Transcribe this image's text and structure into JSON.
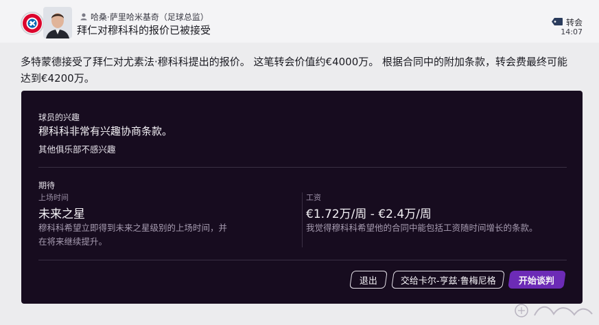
{
  "header": {
    "sender_name": "哈桑·萨里哈米基奇（足球总监）",
    "subject": "拜仁对穆科科的报价已被接受",
    "tag_label": "转会",
    "time": "14:07"
  },
  "message": {
    "body": "多特蒙德接受了拜仁对尤素法·穆科科提出的报价。 这笔转会价值约€4000万。 根据合同中的附加条款，转会费最终可能达到€4200万。"
  },
  "panel": {
    "interest": {
      "label": "球员的兴趣",
      "main": "穆科科非常有兴趣协商条款。",
      "sub": "其他俱乐部不感兴趣"
    },
    "expectation": {
      "label": "期待",
      "playing_time": {
        "label": "上场时间",
        "value": "未来之星",
        "description": "穆科科希望立即得到未来之星级别的上场时间，并在将来继续提升。"
      },
      "wage": {
        "label": "工资",
        "value": "€1.72万/周 - €2.4万/周",
        "description": "我觉得穆科科希望他的合同中能包括工资随时间增长的条款。"
      }
    },
    "buttons": {
      "exit": "退出",
      "delegate": "交给卡尔-亨兹·鲁梅尼格",
      "negotiate": "开始谈判"
    }
  },
  "colors": {
    "panel_bg": "#170c1f",
    "accent": "#6c2bb6",
    "club_red": "#dc052d",
    "club_blue": "#0066b2"
  },
  "icons": {
    "sender": "person-icon",
    "tag": "tag-icon"
  }
}
